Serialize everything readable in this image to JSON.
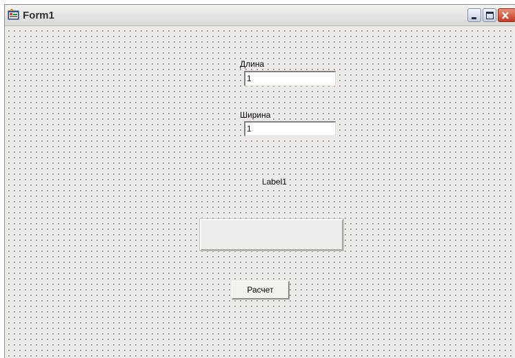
{
  "window": {
    "title": "Form1",
    "icon": "delphi-form-icon",
    "controls": [
      "minimize-icon",
      "maximize-icon",
      "close-icon"
    ]
  },
  "form": {
    "length_label": "Длина",
    "length_value": "1",
    "width_label": "Ширина",
    "width_value": "1",
    "result_label": "Label1",
    "calc_button": "Расчет"
  }
}
